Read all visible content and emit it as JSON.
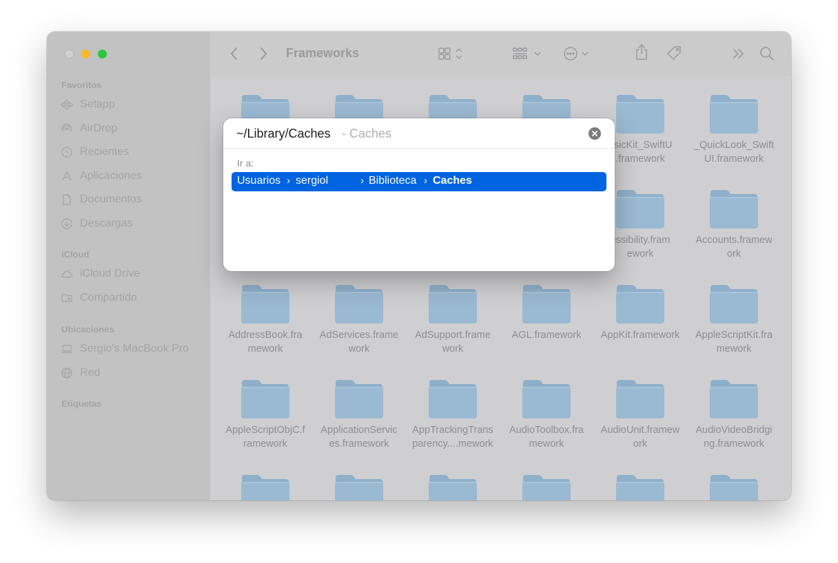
{
  "window": {
    "title": "Frameworks"
  },
  "sidebar": {
    "sections": [
      {
        "label": "Favoritos",
        "items": [
          {
            "label": "Setapp",
            "icon": "setapp-icon"
          },
          {
            "label": "AirDrop",
            "icon": "airdrop-icon"
          },
          {
            "label": "Recientes",
            "icon": "clock-icon"
          },
          {
            "label": "Aplicaciones",
            "icon": "apps-icon"
          },
          {
            "label": "Documentos",
            "icon": "document-icon"
          },
          {
            "label": "Descargas",
            "icon": "download-icon"
          }
        ]
      },
      {
        "label": "iCloud",
        "items": [
          {
            "label": "iCloud Drive",
            "icon": "cloud-icon"
          },
          {
            "label": "Compartido",
            "icon": "shared-folder-icon"
          }
        ]
      },
      {
        "label": "Ubicaciones",
        "items": [
          {
            "label": "Sergio’s MacBook Pro",
            "icon": "laptop-icon"
          },
          {
            "label": "Red",
            "icon": "globe-icon"
          }
        ]
      },
      {
        "label": "Etiquetas",
        "items": []
      }
    ]
  },
  "toolbar": {
    "icons": [
      "back-icon",
      "forward-icon",
      "grid-view-icon",
      "group-icon",
      "more-icon",
      "share-icon",
      "tag-icon",
      "overflow-icon",
      "search-icon"
    ]
  },
  "files": [
    {
      "line1": "",
      "line2": ""
    },
    {
      "line1": "",
      "line2": ""
    },
    {
      "line1": "",
      "line2": ""
    },
    {
      "line1": "",
      "line2": ""
    },
    {
      "line1": "usicKit_SwiftU",
      "line2": ".framework"
    },
    {
      "line1": "_QuickLook_Swift",
      "line2": "UI.framework"
    },
    {
      "line1": "",
      "line2": ""
    },
    {
      "line1": "",
      "line2": ""
    },
    {
      "line1": "",
      "line2": ""
    },
    {
      "line1": "",
      "line2": ""
    },
    {
      "line1": "essibility.fram",
      "line2": "ework"
    },
    {
      "line1": "Accounts.framew",
      "line2": "ork"
    },
    {
      "line1": "AddressBook.fra",
      "line2": "mework"
    },
    {
      "line1": "AdServices.frame",
      "line2": "work"
    },
    {
      "line1": "AdSupport.frame",
      "line2": "work"
    },
    {
      "line1": "AGL.framework",
      "line2": ""
    },
    {
      "line1": "AppKit.framework",
      "line2": ""
    },
    {
      "line1": "AppleScriptKit.fra",
      "line2": "mework"
    },
    {
      "line1": "AppleScriptObjC.f",
      "line2": "ramework"
    },
    {
      "line1": "ApplicationServic",
      "line2": "es.framework"
    },
    {
      "line1": "AppTrackingTrans",
      "line2": "parency....mework"
    },
    {
      "line1": "AudioToolbox.fra",
      "line2": "mework"
    },
    {
      "line1": "AudioUnit.framew",
      "line2": "ork"
    },
    {
      "line1": "AudioVideoBridgi",
      "line2": "ng.framework"
    },
    {
      "line1": "",
      "line2": ""
    },
    {
      "line1": "",
      "line2": ""
    },
    {
      "line1": "",
      "line2": ""
    },
    {
      "line1": "",
      "line2": ""
    },
    {
      "line1": "",
      "line2": ""
    },
    {
      "line1": "",
      "line2": ""
    }
  ],
  "dialog": {
    "input_value": "~/Library/Caches",
    "hint": "- Caches",
    "label": "Ir a:",
    "suggestion": {
      "crumbs": [
        "Usuarios",
        "sergiol",
        "Biblioteca",
        "Caches"
      ],
      "separator": "›"
    }
  },
  "colors": {
    "accent": "#0064e1",
    "folder": "#9ab9d2",
    "window_dimmed": "#cfcfd1"
  }
}
